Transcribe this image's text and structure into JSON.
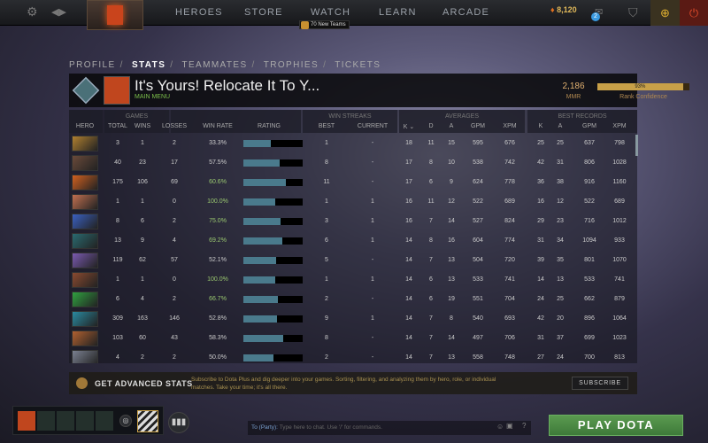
{
  "topbar": {
    "nav": [
      "HEROES",
      "STORE",
      "WATCH",
      "LEARN",
      "ARCADE"
    ],
    "watch_badge": "70 New Teams",
    "shards": "8,120",
    "mail_count": "2"
  },
  "subnav": {
    "items": [
      "PROFILE",
      "STATS",
      "TEAMMATES",
      "TROPHIES",
      "TICKETS"
    ],
    "active": "STATS"
  },
  "profile": {
    "name": "It's Yours! Relocate It To Y...",
    "status": "MAIN MENU",
    "mmr": "2,186",
    "mmr_label": "MMR",
    "confidence": "93%",
    "confidence_value": 0.93,
    "confidence_label": "Rank Confidence"
  },
  "table": {
    "groups": {
      "games": "GAMES",
      "streaks": "WIN STREAKS",
      "averages": "AVERAGES",
      "best": "BEST RECORDS"
    },
    "columns": [
      "HERO",
      "TOTAL",
      "WINS",
      "LOSSES",
      "WIN RATE",
      "RATING",
      "BEST",
      "CURRENT",
      "K ⌄",
      "D",
      "A",
      "GPM",
      "XPM",
      "K",
      "A",
      "GPM",
      "XPM"
    ],
    "rows": [
      {
        "color": "#b08030",
        "total": "3",
        "wins": "1",
        "losses": "2",
        "winrate": "33.3%",
        "rating": 0.46,
        "best": "1",
        "current": "-",
        "k": "18",
        "d": "11",
        "a": "15",
        "gpm": "595",
        "xpm": "676",
        "bk": "25",
        "ba": "25",
        "bgpm": "637",
        "bxpm": "798"
      },
      {
        "color": "#6a4a3a",
        "total": "40",
        "wins": "23",
        "losses": "17",
        "winrate": "57.5%",
        "rating": 0.61,
        "best": "8",
        "current": "-",
        "k": "17",
        "d": "8",
        "a": "10",
        "gpm": "538",
        "xpm": "742",
        "bk": "42",
        "ba": "31",
        "bgpm": "806",
        "bxpm": "1028"
      },
      {
        "color": "#d06020",
        "total": "175",
        "wins": "106",
        "losses": "69",
        "winrate": "60.6%",
        "rating": 0.72,
        "best": "11",
        "current": "-",
        "k": "17",
        "d": "6",
        "a": "9",
        "gpm": "624",
        "xpm": "778",
        "bk": "36",
        "ba": "38",
        "bgpm": "916",
        "bxpm": "1160"
      },
      {
        "color": "#c07050",
        "total": "1",
        "wins": "1",
        "losses": "0",
        "winrate": "100.0%",
        "rating": 0.54,
        "best": "1",
        "current": "1",
        "k": "16",
        "d": "11",
        "a": "12",
        "gpm": "522",
        "xpm": "689",
        "bk": "16",
        "ba": "12",
        "bgpm": "522",
        "bxpm": "689"
      },
      {
        "color": "#3a60c0",
        "total": "8",
        "wins": "6",
        "losses": "2",
        "winrate": "75.0%",
        "rating": 0.63,
        "best": "3",
        "current": "1",
        "k": "16",
        "d": "7",
        "a": "14",
        "gpm": "527",
        "xpm": "824",
        "bk": "29",
        "ba": "23",
        "bgpm": "716",
        "bxpm": "1012"
      },
      {
        "color": "#2a6a70",
        "total": "13",
        "wins": "9",
        "losses": "4",
        "winrate": "69.2%",
        "rating": 0.65,
        "best": "6",
        "current": "1",
        "k": "14",
        "d": "8",
        "a": "16",
        "gpm": "604",
        "xpm": "774",
        "bk": "31",
        "ba": "34",
        "bgpm": "1094",
        "bxpm": "933"
      },
      {
        "color": "#7a5ab0",
        "total": "119",
        "wins": "62",
        "losses": "57",
        "winrate": "52.1%",
        "rating": 0.55,
        "best": "5",
        "current": "-",
        "k": "14",
        "d": "7",
        "a": "13",
        "gpm": "504",
        "xpm": "720",
        "bk": "39",
        "ba": "35",
        "bgpm": "801",
        "bxpm": "1070"
      },
      {
        "color": "#8a4a30",
        "total": "1",
        "wins": "1",
        "losses": "0",
        "winrate": "100.0%",
        "rating": 0.54,
        "best": "1",
        "current": "1",
        "k": "14",
        "d": "6",
        "a": "13",
        "gpm": "533",
        "xpm": "741",
        "bk": "14",
        "ba": "13",
        "bgpm": "533",
        "bxpm": "741"
      },
      {
        "color": "#30a040",
        "total": "6",
        "wins": "4",
        "losses": "2",
        "winrate": "66.7%",
        "rating": 0.58,
        "best": "2",
        "current": "-",
        "k": "14",
        "d": "6",
        "a": "19",
        "gpm": "551",
        "xpm": "704",
        "bk": "24",
        "ba": "25",
        "bgpm": "662",
        "bxpm": "879"
      },
      {
        "color": "#2a8aa0",
        "total": "309",
        "wins": "163",
        "losses": "146",
        "winrate": "52.8%",
        "rating": 0.57,
        "best": "9",
        "current": "1",
        "k": "14",
        "d": "7",
        "a": "8",
        "gpm": "540",
        "xpm": "693",
        "bk": "42",
        "ba": "20",
        "bgpm": "896",
        "bxpm": "1064"
      },
      {
        "color": "#b06030",
        "total": "103",
        "wins": "60",
        "losses": "43",
        "winrate": "58.3%",
        "rating": 0.67,
        "best": "8",
        "current": "-",
        "k": "14",
        "d": "7",
        "a": "14",
        "gpm": "497",
        "xpm": "706",
        "bk": "31",
        "ba": "37",
        "bgpm": "699",
        "bxpm": "1023"
      },
      {
        "color": "#7a8090",
        "total": "4",
        "wins": "2",
        "losses": "2",
        "winrate": "50.0%",
        "rating": 0.5,
        "best": "2",
        "current": "-",
        "k": "14",
        "d": "7",
        "a": "13",
        "gpm": "558",
        "xpm": "748",
        "bk": "27",
        "ba": "24",
        "bgpm": "700",
        "bxpm": "813"
      }
    ]
  },
  "advanced": {
    "title": "GET ADVANCED STATS",
    "description": "Subscribe to Dota Plus and dig deeper into your games. Sorting, filtering, and analyzing them by hero, role, or individual matches. Take your time; it's all there.",
    "button": "SUBSCRIBE"
  },
  "chat": {
    "channel": "To (Party):",
    "placeholder": "Type here to chat. Use '/' for commands."
  },
  "play_button": "PLAY DOTA",
  "colors": {
    "accent_gold": "#c8a048",
    "win_green": "#9ac870",
    "bar": "#4a7a8c",
    "play": "#4e8a46"
  }
}
